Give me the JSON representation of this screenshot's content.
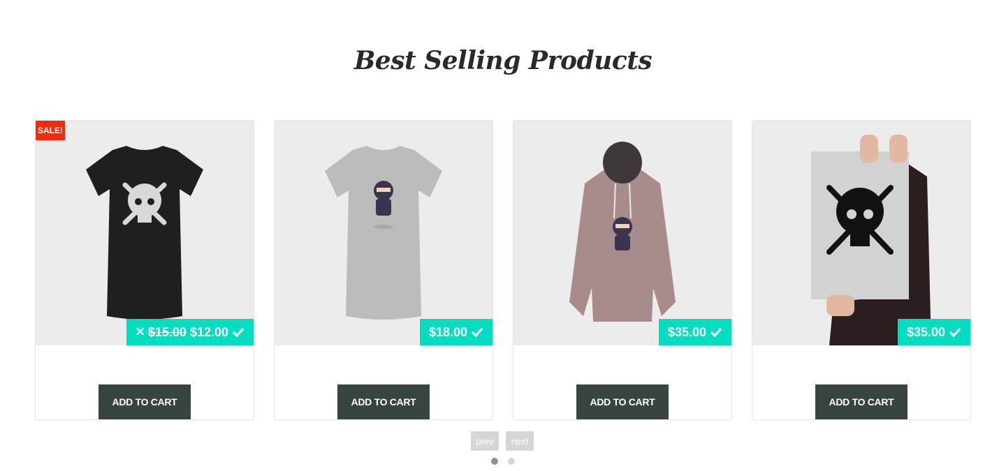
{
  "section": {
    "title": "Best Selling Products"
  },
  "products": [
    {
      "badge": "SALE!",
      "old_price": "$15.00",
      "price": "$12.00",
      "button": "ADD TO CART",
      "image_icon": "black-skull-tshirt"
    },
    {
      "price": "$18.00",
      "button": "ADD TO CART",
      "image_icon": "grey-ninja-tshirt"
    },
    {
      "price": "$35.00",
      "button": "ADD TO CART",
      "image_icon": "pink-ninja-hoodie"
    },
    {
      "price": "$35.00",
      "button": "ADD TO CART",
      "image_icon": "skull-poster"
    }
  ],
  "pager": {
    "prev": "prev",
    "next": "next",
    "pages": 2,
    "current": 1
  },
  "colors": {
    "accent": "#00ddc0",
    "button": "#384442",
    "sale": "#f42a0e"
  }
}
